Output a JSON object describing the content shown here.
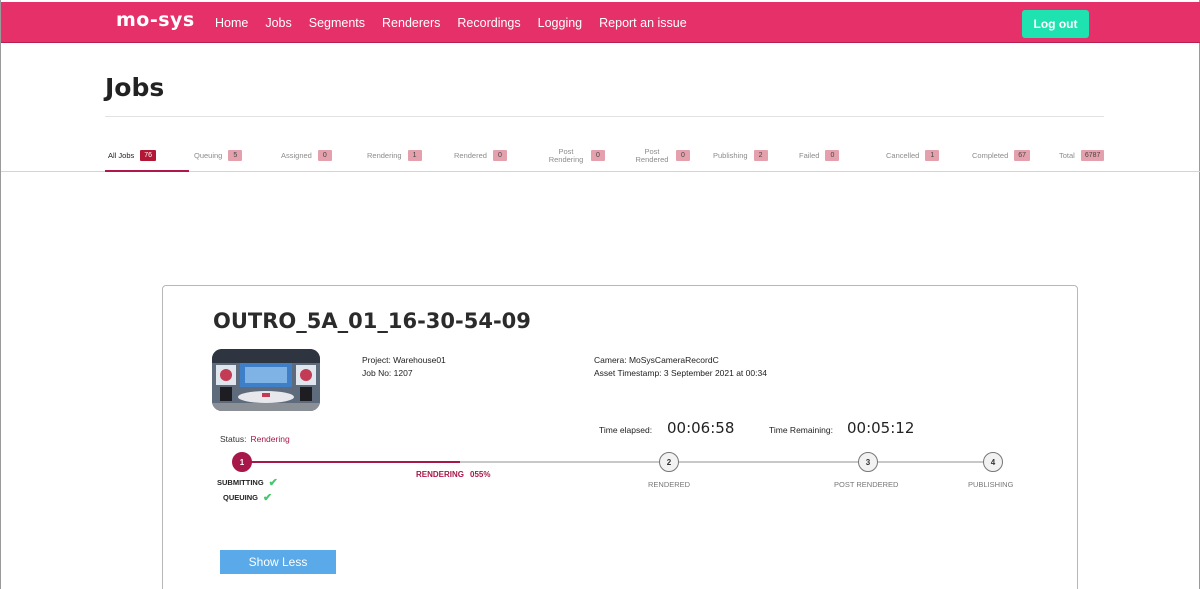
{
  "brand": "mo-sys",
  "nav": {
    "items": [
      "Home",
      "Jobs",
      "Segments",
      "Renderers",
      "Recordings",
      "Logging",
      "Report an issue"
    ],
    "logout_label": "Log out"
  },
  "page_title": "Jobs",
  "tabs": [
    {
      "label": "All Jobs",
      "count": "76",
      "active": true
    },
    {
      "label": "Queuing",
      "count": "5"
    },
    {
      "label": "Assigned",
      "count": "0"
    },
    {
      "label": "Rendering",
      "count": "1"
    },
    {
      "label": "Rendered",
      "count": "0"
    },
    {
      "label": "Post Rendering",
      "count": "0"
    },
    {
      "label": "Post Rendered",
      "count": "0"
    },
    {
      "label": "Publishing",
      "count": "2"
    },
    {
      "label": "Failed",
      "count": "0"
    },
    {
      "label": "Cancelled",
      "count": "1"
    },
    {
      "label": "Completed",
      "count": "67"
    },
    {
      "label": "Total",
      "count": "6787"
    }
  ],
  "job": {
    "name": "OUTRO_5A_01_16-30-54-09",
    "project": "Project: Warehouse01",
    "job_no": "Job No: 1207",
    "camera": "Camera: MoSysCameraRecordC",
    "asset_timestamp": "Asset Timestamp: 3 September 2021 at 00:34",
    "status_label": "Status:",
    "status_value": "Rendering",
    "time_elapsed_label": "Time elapsed:",
    "time_elapsed": "00:06:58",
    "time_remaining_label": "Time Remaining:",
    "time_remaining": "00:05:12",
    "progress_fraction": 0.29,
    "steps": [
      {
        "number": "1",
        "label": "",
        "done": true
      },
      {
        "number": "2",
        "label": "RENDERED"
      },
      {
        "number": "3",
        "label": "POST RENDERED"
      },
      {
        "number": "4",
        "label": "PUBLISHING"
      }
    ],
    "sub_steps": [
      "SUBMITTING",
      "QUEUING"
    ],
    "rendering_label": "RENDERING",
    "rendering_percent": "055%",
    "show_less_label": "Show Less"
  },
  "colors": {
    "nav_bg": "#e6306a",
    "logout_bg": "#1ee2b0",
    "accent": "#a8174a",
    "badge": "#e4a1ad",
    "check": "#46c86a",
    "button_blue": "#5aa9e8"
  }
}
